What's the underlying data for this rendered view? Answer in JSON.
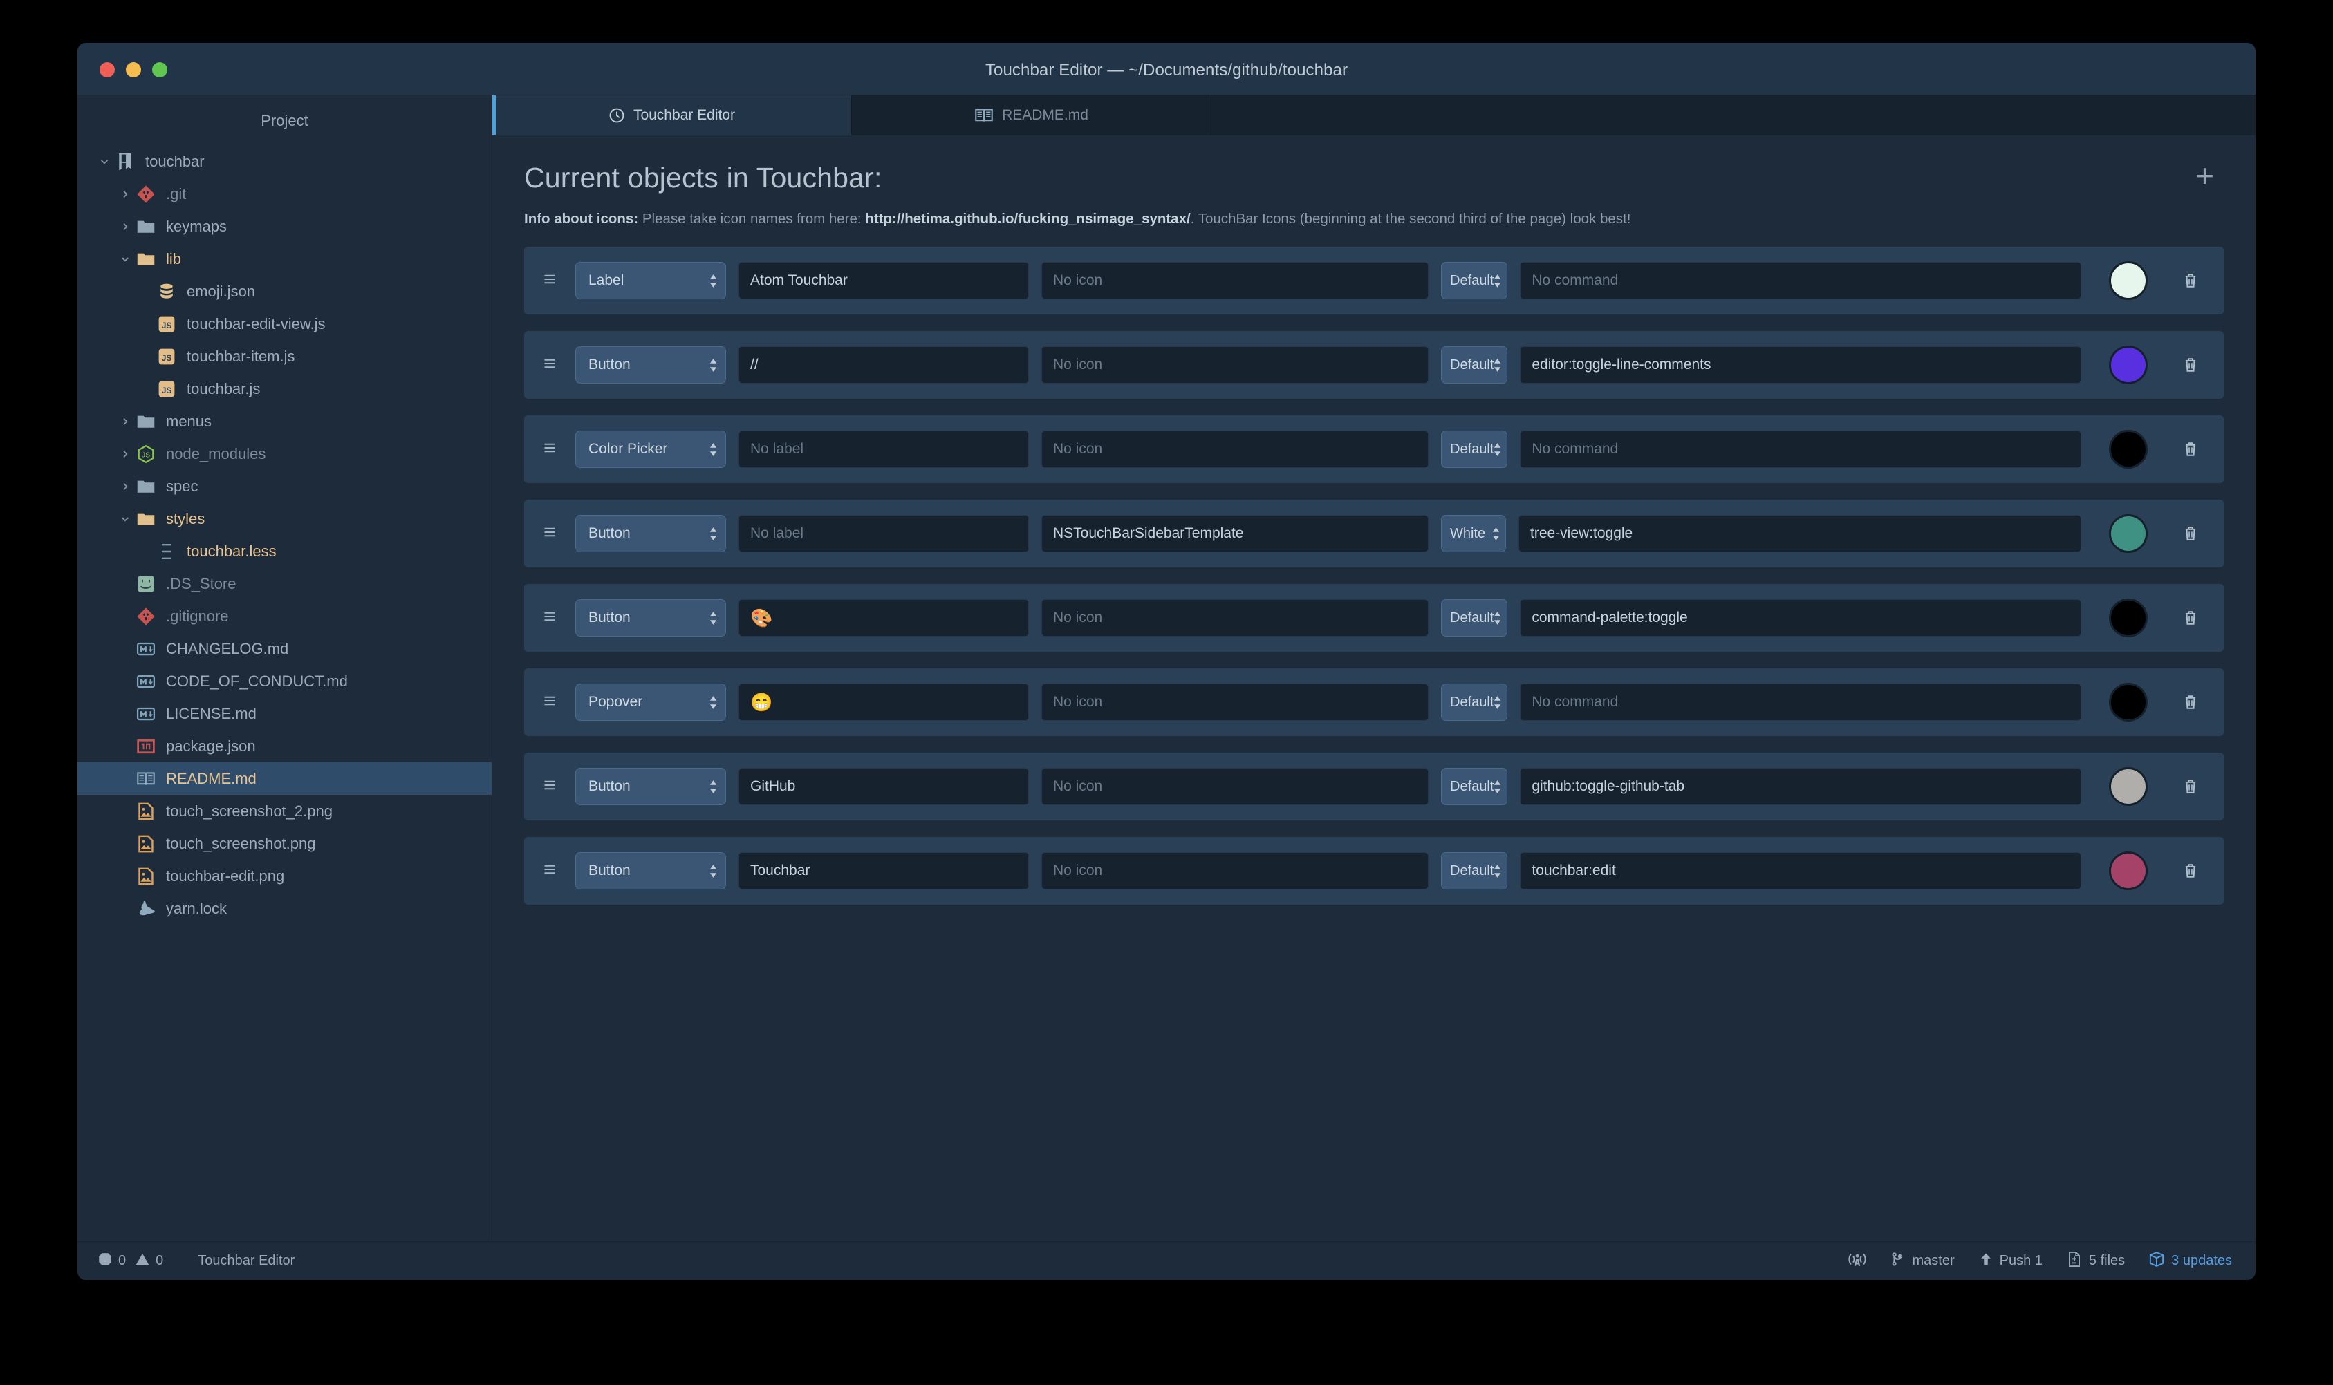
{
  "window": {
    "title": "Touchbar Editor — ~/Documents/github/touchbar",
    "traffic_lights": [
      "close-red",
      "minimize-yellow",
      "zoom-green"
    ]
  },
  "sidebar": {
    "title": "Project",
    "items": [
      {
        "label": "touchbar",
        "icon": "repo-icon",
        "indent": 0,
        "arrow": "down",
        "selected": false,
        "color": "normal"
      },
      {
        "label": ".git",
        "icon": "git-icon",
        "indent": 1,
        "arrow": "right",
        "selected": false,
        "color": "dim"
      },
      {
        "label": "keymaps",
        "icon": "folder-icon",
        "indent": 1,
        "arrow": "right",
        "selected": false,
        "color": "normal"
      },
      {
        "label": "lib",
        "icon": "folder-open-icon",
        "indent": 1,
        "arrow": "down",
        "selected": false,
        "color": "highlight"
      },
      {
        "label": "emoji.json",
        "icon": "database-icon",
        "indent": 2,
        "arrow": "none",
        "selected": false,
        "color": "normal"
      },
      {
        "label": "touchbar-edit-view.js",
        "icon": "js-icon",
        "indent": 2,
        "arrow": "none",
        "selected": false,
        "color": "normal"
      },
      {
        "label": "touchbar-item.js",
        "icon": "js-icon",
        "indent": 2,
        "arrow": "none",
        "selected": false,
        "color": "normal"
      },
      {
        "label": "touchbar.js",
        "icon": "js-icon",
        "indent": 2,
        "arrow": "none",
        "selected": false,
        "color": "normal"
      },
      {
        "label": "menus",
        "icon": "folder-icon",
        "indent": 1,
        "arrow": "right",
        "selected": false,
        "color": "normal"
      },
      {
        "label": "node_modules",
        "icon": "node-icon",
        "indent": 1,
        "arrow": "right",
        "selected": false,
        "color": "dim"
      },
      {
        "label": "spec",
        "icon": "folder-icon",
        "indent": 1,
        "arrow": "right",
        "selected": false,
        "color": "normal"
      },
      {
        "label": "styles",
        "icon": "folder-open-icon",
        "indent": 1,
        "arrow": "down",
        "selected": false,
        "color": "highlight"
      },
      {
        "label": "touchbar.less",
        "icon": "less-icon",
        "indent": 2,
        "arrow": "none",
        "selected": false,
        "color": "highlight"
      },
      {
        "label": ".DS_Store",
        "icon": "finder-icon",
        "indent": 1,
        "arrow": "none",
        "selected": false,
        "color": "dim"
      },
      {
        "label": ".gitignore",
        "icon": "git-icon",
        "indent": 1,
        "arrow": "none",
        "selected": false,
        "color": "dim"
      },
      {
        "label": "CHANGELOG.md",
        "icon": "markdown-icon",
        "indent": 1,
        "arrow": "none",
        "selected": false,
        "color": "normal"
      },
      {
        "label": "CODE_OF_CONDUCT.md",
        "icon": "markdown-icon",
        "indent": 1,
        "arrow": "none",
        "selected": false,
        "color": "normal"
      },
      {
        "label": "LICENSE.md",
        "icon": "markdown-icon",
        "indent": 1,
        "arrow": "none",
        "selected": false,
        "color": "normal"
      },
      {
        "label": "package.json",
        "icon": "npm-icon",
        "indent": 1,
        "arrow": "none",
        "selected": false,
        "color": "normal"
      },
      {
        "label": "README.md",
        "icon": "book-icon",
        "indent": 1,
        "arrow": "none",
        "selected": true,
        "color": "highlight"
      },
      {
        "label": "touch_screenshot_2.png",
        "icon": "image-icon",
        "indent": 1,
        "arrow": "none",
        "selected": false,
        "color": "normal"
      },
      {
        "label": "touch_screenshot.png",
        "icon": "image-icon",
        "indent": 1,
        "arrow": "none",
        "selected": false,
        "color": "normal"
      },
      {
        "label": "touchbar-edit.png",
        "icon": "image-icon",
        "indent": 1,
        "arrow": "none",
        "selected": false,
        "color": "normal"
      },
      {
        "label": "yarn.lock",
        "icon": "yarn-icon",
        "indent": 1,
        "arrow": "none",
        "selected": false,
        "color": "normal"
      }
    ]
  },
  "tabs": [
    {
      "label": "Touchbar Editor",
      "icon": "touchbar-editor-icon",
      "active": true
    },
    {
      "label": "README.md",
      "icon": "book-icon",
      "active": false
    }
  ],
  "main": {
    "page_title": "Current objects in Touchbar:",
    "add_button": "+",
    "info": {
      "bold_prefix": "Info about icons:",
      "text_before": " Please take icon names from here: ",
      "link": "http://hetima.github.io/fucking_nsimage_syntax/",
      "text_after": ". TouchBar Icons (beginning at the second third of the page) look best!"
    },
    "placeholders": {
      "label": "No label",
      "icon": "No icon",
      "command": "No command"
    },
    "rows": [
      {
        "type": "Label",
        "label": "Atom Touchbar",
        "label_is_placeholder": false,
        "icon": "",
        "color_select": "Default",
        "command": "",
        "swatch": "#e6f6ec"
      },
      {
        "type": "Button",
        "label": "//",
        "label_is_placeholder": false,
        "icon": "",
        "color_select": "Default",
        "command": "editor:toggle-line-comments",
        "swatch": "#5930e0"
      },
      {
        "type": "Color Picker",
        "label": "",
        "label_is_placeholder": true,
        "icon": "",
        "color_select": "Default",
        "command": "",
        "swatch": "#000000"
      },
      {
        "type": "Button",
        "label": "",
        "label_is_placeholder": true,
        "icon": "NSTouchBarSidebarTemplate",
        "color_select": "White",
        "command": "tree-view:toggle",
        "swatch": "#3f9283"
      },
      {
        "type": "Button",
        "label": "🎨",
        "label_is_placeholder": false,
        "icon": "",
        "color_select": "Default",
        "command": "command-palette:toggle",
        "swatch": "#000000"
      },
      {
        "type": "Popover",
        "label": "😁",
        "label_is_placeholder": false,
        "icon": "",
        "color_select": "Default",
        "command": "",
        "swatch": "#000000"
      },
      {
        "type": "Button",
        "label": "GitHub",
        "label_is_placeholder": false,
        "icon": "",
        "color_select": "Default",
        "command": "github:toggle-github-tab",
        "swatch": "#b0aeab"
      },
      {
        "type": "Button",
        "label": "Touchbar",
        "label_is_placeholder": false,
        "icon": "",
        "color_select": "Default",
        "command": "touchbar:edit",
        "swatch": "#a44367"
      }
    ]
  },
  "statusbar": {
    "errors": "0",
    "warnings": "0",
    "title": "Touchbar Editor",
    "right": [
      {
        "label": "",
        "icon": "live-share-icon"
      },
      {
        "label": "master",
        "icon": "branch-icon"
      },
      {
        "label": "Push 1",
        "icon": "arrow-up-icon"
      },
      {
        "label": "5 files",
        "icon": "diff-file-icon"
      },
      {
        "label": "3 updates",
        "icon": "package-icon",
        "accent": true
      }
    ]
  },
  "colors": {
    "accent_blue": "#4aa3df",
    "row_bg": "#294056",
    "window_bg": "#1d2b3a",
    "titlebar_bg": "#223548",
    "selection_bg": "#2f4d6b"
  }
}
